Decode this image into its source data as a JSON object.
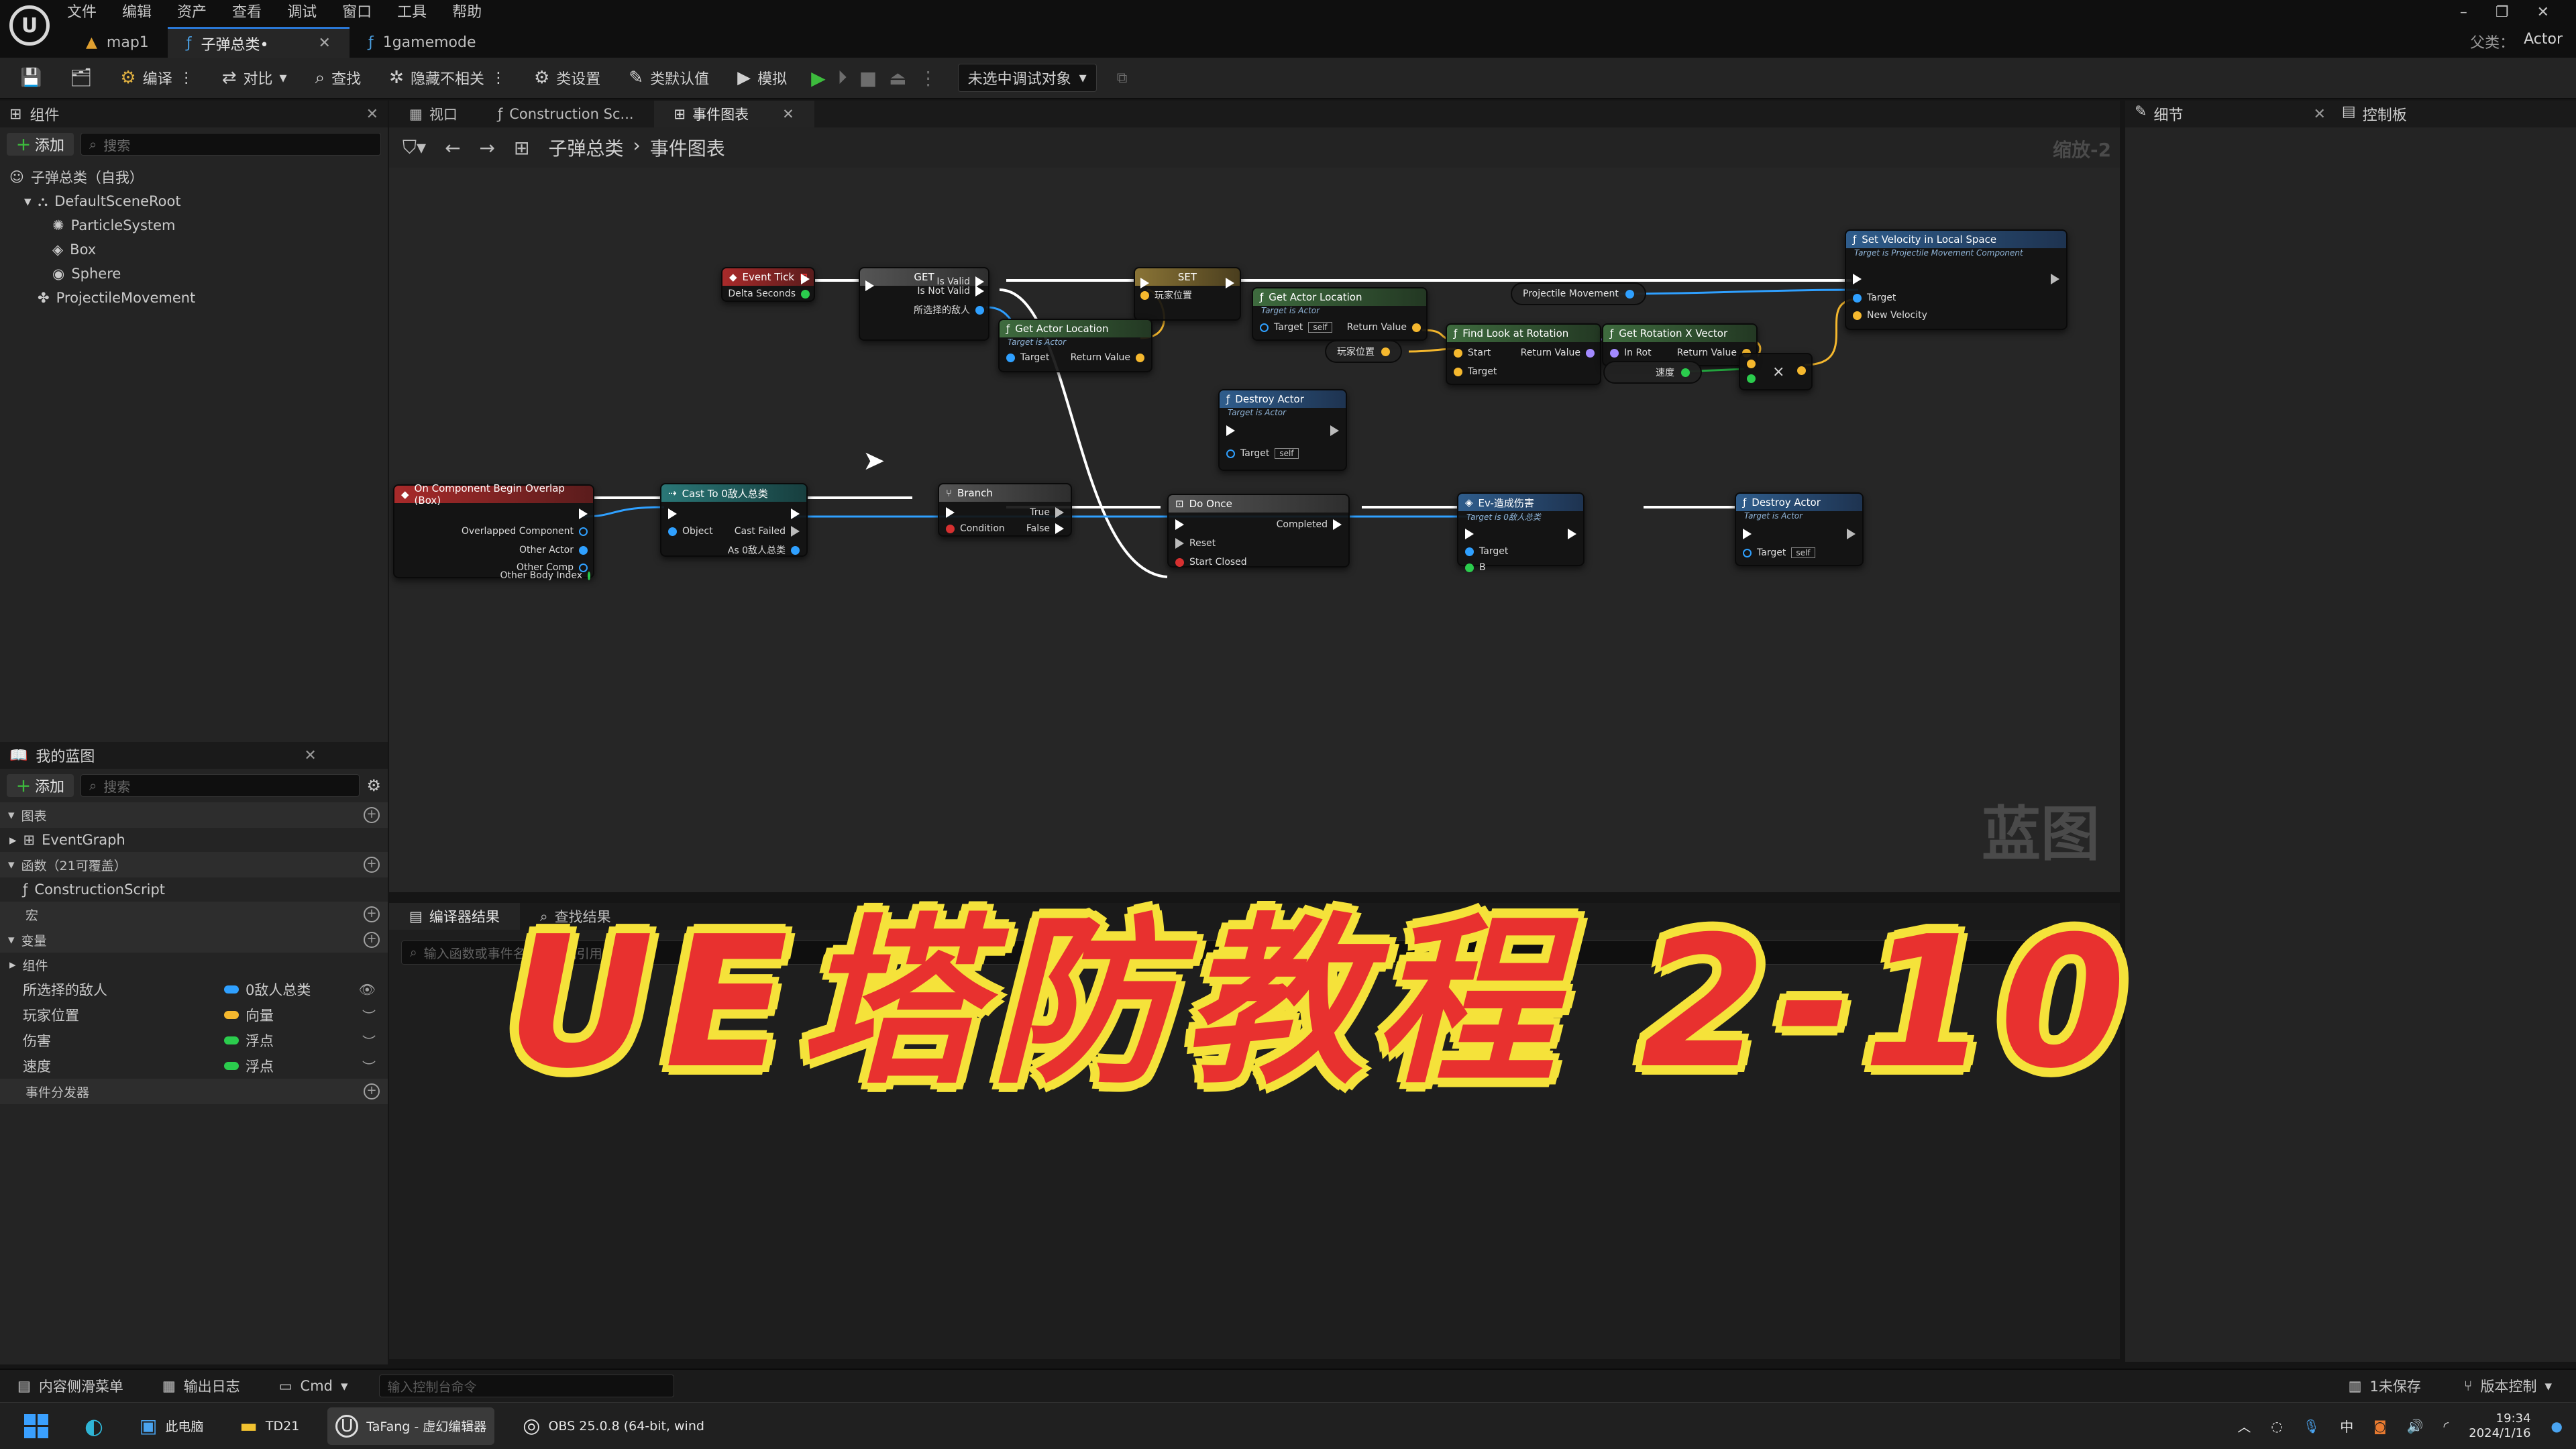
{
  "menu": [
    "文件",
    "编辑",
    "资产",
    "查看",
    "调试",
    "窗口",
    "工具",
    "帮助"
  ],
  "tabs": [
    {
      "label": "map1",
      "icon": "map-icon"
    },
    {
      "label": "子弹总类•",
      "icon": "blueprint-icon",
      "active": true
    },
    {
      "label": "1gamemode",
      "icon": "blueprint-icon"
    }
  ],
  "window_controls": {
    "minimize": "–",
    "restore": "❐",
    "close": "✕"
  },
  "parent_class": {
    "label": "父类：",
    "value": "Actor"
  },
  "toolbar": {
    "compile": "编译",
    "diff": "对比",
    "find": "查找",
    "hide_unrelated": "隐藏不相关",
    "class_settings": "类设置",
    "class_defaults": "类默认值",
    "simulate": "模拟",
    "debug_target": "未选中调试对象"
  },
  "components_panel": {
    "title": "组件",
    "add": "添加",
    "search_placeholder": "搜索",
    "items": [
      "子弹总类（自我）",
      "DefaultSceneRoot",
      "ParticleSystem",
      "Box",
      "Sphere",
      "ProjectileMovement"
    ]
  },
  "my_blueprint": {
    "title": "我的蓝图",
    "add": "添加",
    "search_placeholder": "搜索",
    "graphs_header": "图表",
    "event_graph": "EventGraph",
    "functions_header": "函数（21可覆盖）",
    "construction_script": "ConstructionScript",
    "macros_header": "宏",
    "variables_header": "变量",
    "components_sub": "组件",
    "variables": [
      {
        "name": "所选择的敌人",
        "type": "0敌人总类",
        "color": "#2fa0ff"
      },
      {
        "name": "玩家位置",
        "type": "向量",
        "color": "#f5b82e"
      },
      {
        "name": "伤害",
        "type": "浮点",
        "color": "#2bcc4d"
      },
      {
        "name": "速度",
        "type": "浮点",
        "color": "#2bcc4d"
      }
    ],
    "dispatchers_header": "事件分发器"
  },
  "graph_tabs": [
    {
      "label": "视口"
    },
    {
      "label": "Construction Sc..."
    },
    {
      "label": "事件图表",
      "active": true
    }
  ],
  "breadcrumb": [
    "子弹总类",
    "事件图表"
  ],
  "zoom": "缩放-2",
  "watermark": "蓝图",
  "nodes": {
    "event_tick": {
      "title": "Event Tick",
      "pin": "Delta Seconds"
    },
    "get": {
      "title": "GET",
      "is_valid": "Is Valid",
      "is_not_valid": "Is Not Valid",
      "input": "所选择的敌人"
    },
    "set": {
      "title": "SET",
      "pin": "玩家位置"
    },
    "set_velocity": {
      "title": "Set Velocity in Local Space",
      "subtitle": "Target is Projectile Movement Component",
      "target": "Target",
      "new_velocity": "New Velocity"
    },
    "projectile_movement": "Projectile Movement",
    "get_actor_loc_1": {
      "title": "Get Actor Location",
      "subtitle": "Target is Actor",
      "target": "Target",
      "ret": "Return Value"
    },
    "get_actor_loc_2": {
      "title": "Get Actor Location",
      "subtitle": "Target is Actor",
      "target": "Target",
      "self": "self",
      "ret": "Return Value"
    },
    "find_look": {
      "title": "Find Look at Rotation",
      "start": "Start",
      "target": "Target",
      "ret": "Return Value"
    },
    "get_rot_x": {
      "title": "Get Rotation X Vector",
      "in_rot": "In Rot",
      "ret": "Return Value"
    },
    "player_pos_var": "玩家位置",
    "speed_var": "速度",
    "multiply": "×",
    "destroy_1": {
      "title": "Destroy Actor",
      "subtitle": "Target is Actor",
      "target": "Target",
      "self": "self"
    },
    "overlap": {
      "title": "On Component Begin Overlap (Box)",
      "p1": "Overlapped Component",
      "p2": "Other Actor",
      "p3": "Other Comp",
      "p4": "Other Body Index"
    },
    "cast": {
      "title": "Cast To 0敌人总类",
      "object": "Object",
      "failed": "Cast Failed",
      "as": "As 0敌人总类"
    },
    "branch": {
      "title": "Branch",
      "condition": "Condition",
      "t": "True",
      "f": "False"
    },
    "do_once": {
      "title": "Do Once",
      "completed": "Completed",
      "reset": "Reset",
      "start_closed": "Start Closed"
    },
    "ev_damage": {
      "title": "Ev-造成伤害",
      "subtitle": "Target is 0敌人总类",
      "target": "Target",
      "b": "B"
    },
    "destroy_2": {
      "title": "Destroy Actor",
      "subtitle": "Target is Actor",
      "target": "Target",
      "self": "self"
    }
  },
  "bottom_panel": {
    "tabs": [
      "编译器结果",
      "查找结果"
    ],
    "search_placeholder": "输入函数或事件名称来查找引用..."
  },
  "details_panel": {
    "tabs": [
      "细节",
      "控制板"
    ]
  },
  "status_bar": {
    "content_drawer": "内容侧滑菜单",
    "output_log": "输出日志",
    "cmd": "Cmd",
    "cmd_placeholder": "输入控制台命令",
    "unsaved": "1未保存",
    "source_control": "版本控制"
  },
  "taskbar": {
    "items": [
      "此电脑",
      "TD21",
      "TaFang - 虚幻编辑器",
      "OBS 25.0.8 (64-bit, wind"
    ],
    "ime": "中",
    "time": "19:34",
    "date": "2024/1/16"
  },
  "overlay_title": "UE塔防教程 2-10"
}
